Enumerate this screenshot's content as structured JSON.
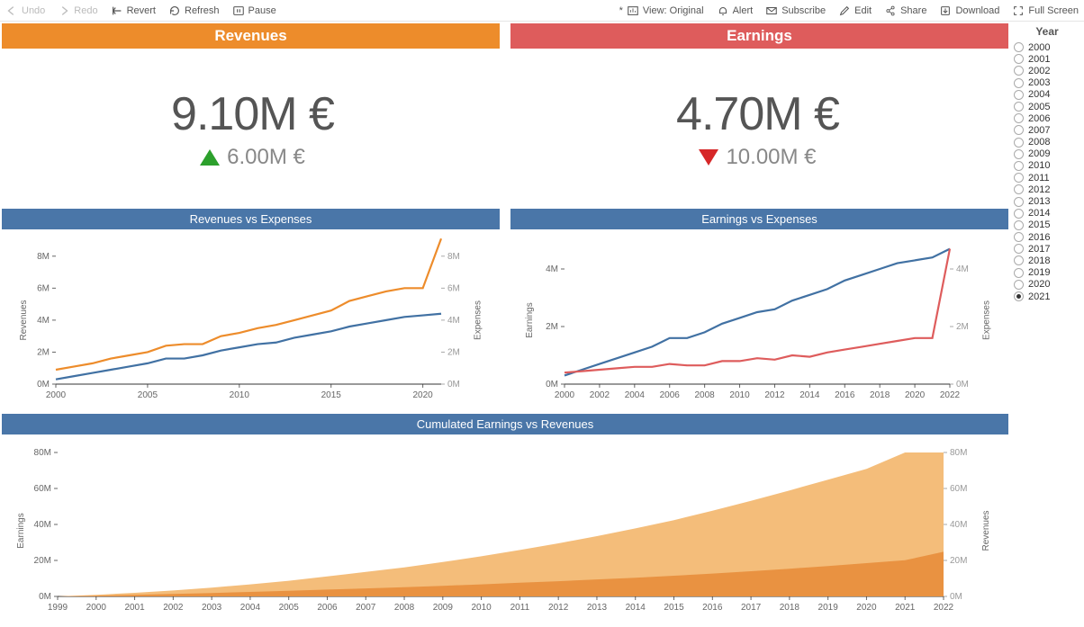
{
  "toolbar": {
    "left": {
      "undo": "Undo",
      "redo": "Redo",
      "revert": "Revert",
      "refresh": "Refresh",
      "pause": "Pause"
    },
    "right": {
      "view_prefix": "*",
      "view": "View: Original",
      "alert": "Alert",
      "subscribe": "Subscribe",
      "edit": "Edit",
      "share": "Share",
      "download": "Download",
      "fullscreen": "Full Screen"
    }
  },
  "headers": {
    "revenues": "Revenues",
    "earnings": "Earnings"
  },
  "kpi": {
    "revenues_value": "9.10M €",
    "revenues_delta": "6.00M €",
    "revenues_direction": "up",
    "earnings_value": "4.70M €",
    "earnings_delta": "10.00M €",
    "earnings_direction": "down"
  },
  "panels": {
    "rev_exp": "Revenues vs Expenses",
    "earn_exp": "Earnings vs Expenses",
    "cumulated": "Cumulated Earnings vs Revenues"
  },
  "axis_labels": {
    "revenues": "Revenues",
    "expenses": "Expenses",
    "earnings": "Earnings"
  },
  "year_filter": {
    "title": "Year",
    "years": [
      "2000",
      "2001",
      "2002",
      "2003",
      "2004",
      "2005",
      "2006",
      "2007",
      "2008",
      "2009",
      "2010",
      "2011",
      "2012",
      "2013",
      "2014",
      "2015",
      "2016",
      "2017",
      "2018",
      "2019",
      "2020",
      "2021"
    ],
    "selected": "2021"
  },
  "colors": {
    "orange": "#ed8c2b",
    "red": "#de5c5c",
    "blue_header": "#4a76a8",
    "line_blue": "#4171a3",
    "line_orange": "#ed8c2b",
    "line_red": "#de5c5c",
    "area_light": "#f3b973",
    "area_dark": "#e88f3e"
  },
  "chart_data": [
    {
      "id": "rev_exp",
      "type": "line",
      "title": "Revenues vs Expenses",
      "xlabel": "",
      "ylabel_left": "Revenues",
      "ylabel_right": "Expenses",
      "ylim": [
        0,
        9
      ],
      "x": [
        2000,
        2001,
        2002,
        2003,
        2004,
        2005,
        2006,
        2007,
        2008,
        2009,
        2010,
        2011,
        2012,
        2013,
        2014,
        2015,
        2016,
        2017,
        2018,
        2019,
        2020,
        2021
      ],
      "series": [
        {
          "name": "Revenues",
          "color": "#ed8c2b",
          "values": [
            0.9,
            1.1,
            1.3,
            1.6,
            1.8,
            2.0,
            2.4,
            2.5,
            2.5,
            3.0,
            3.2,
            3.5,
            3.7,
            4.0,
            4.3,
            4.6,
            5.2,
            5.5,
            5.8,
            6.0,
            6.0,
            9.1
          ]
        },
        {
          "name": "Expenses",
          "color": "#4171a3",
          "values": [
            0.3,
            0.5,
            0.7,
            0.9,
            1.1,
            1.3,
            1.6,
            1.6,
            1.8,
            2.1,
            2.3,
            2.5,
            2.6,
            2.9,
            3.1,
            3.3,
            3.6,
            3.8,
            4.0,
            4.2,
            4.3,
            4.4
          ]
        }
      ],
      "yticks_left": [
        0,
        2,
        4,
        6,
        8
      ],
      "yticks_right": [
        0,
        2,
        4,
        6,
        8
      ],
      "xticks": [
        2000,
        2005,
        2010,
        2015,
        2020
      ]
    },
    {
      "id": "earn_exp",
      "type": "line",
      "title": "Earnings vs Expenses",
      "xlabel": "",
      "ylabel_left": "Earnings",
      "ylabel_right": "Expenses",
      "ylim": [
        0,
        5
      ],
      "x": [
        2000,
        2001,
        2002,
        2003,
        2004,
        2005,
        2006,
        2007,
        2008,
        2009,
        2010,
        2011,
        2012,
        2013,
        2014,
        2015,
        2016,
        2017,
        2018,
        2019,
        2020,
        2021,
        2022
      ],
      "series": [
        {
          "name": "Earnings",
          "color": "#4171a3",
          "values": [
            0.3,
            0.5,
            0.7,
            0.9,
            1.1,
            1.3,
            1.6,
            1.6,
            1.8,
            2.1,
            2.3,
            2.5,
            2.6,
            2.9,
            3.1,
            3.3,
            3.6,
            3.8,
            4.0,
            4.2,
            4.3,
            4.4,
            4.7
          ]
        },
        {
          "name": "Expenses",
          "color": "#de5c5c",
          "values": [
            0.4,
            0.45,
            0.5,
            0.55,
            0.6,
            0.6,
            0.7,
            0.65,
            0.65,
            0.8,
            0.8,
            0.9,
            0.85,
            1.0,
            0.95,
            1.1,
            1.2,
            1.3,
            1.4,
            1.5,
            1.6,
            1.6,
            4.7
          ]
        }
      ],
      "yticks_left": [
        0,
        2,
        4
      ],
      "yticks_right": [
        0,
        2,
        4
      ],
      "xticks": [
        2000,
        2002,
        2004,
        2006,
        2008,
        2010,
        2012,
        2014,
        2016,
        2018,
        2020,
        2022
      ]
    },
    {
      "id": "cumulated",
      "type": "area",
      "title": "Cumulated Earnings vs Revenues",
      "xlabel": "",
      "ylabel_left": "Earnings",
      "ylabel_right": "Revenues",
      "ylim": [
        0,
        85
      ],
      "x": [
        1999,
        2000,
        2001,
        2002,
        2003,
        2004,
        2005,
        2006,
        2007,
        2008,
        2009,
        2010,
        2011,
        2012,
        2013,
        2014,
        2015,
        2016,
        2017,
        2018,
        2019,
        2020,
        2021,
        2022
      ],
      "series": [
        {
          "name": "Cumulated Revenues",
          "color": "#f3b973",
          "values": [
            0,
            0.9,
            2.0,
            3.3,
            4.9,
            6.7,
            8.7,
            11.1,
            13.6,
            16.1,
            19.1,
            22.3,
            25.8,
            29.5,
            33.5,
            37.8,
            42.4,
            47.6,
            53.1,
            58.9,
            64.9,
            70.9,
            80.0,
            80.0
          ]
        },
        {
          "name": "Cumulated Earnings",
          "color": "#e88f3e",
          "values": [
            0,
            0.4,
            0.85,
            1.35,
            1.9,
            2.5,
            3.1,
            3.8,
            4.45,
            5.1,
            5.9,
            6.7,
            7.6,
            8.45,
            9.45,
            10.4,
            11.5,
            12.7,
            14.0,
            15.4,
            16.9,
            18.5,
            20.1,
            24.8
          ]
        }
      ],
      "yticks_left": [
        0,
        20,
        40,
        60,
        80
      ],
      "yticks_right": [
        0,
        20,
        40,
        60,
        80
      ],
      "xticks": [
        1999,
        2000,
        2001,
        2002,
        2003,
        2004,
        2005,
        2006,
        2007,
        2008,
        2009,
        2010,
        2011,
        2012,
        2013,
        2014,
        2015,
        2016,
        2017,
        2018,
        2019,
        2020,
        2021,
        2022
      ]
    }
  ]
}
